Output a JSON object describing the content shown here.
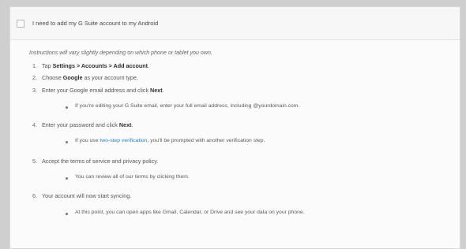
{
  "header": {
    "title": "I need to add my G Suite account to my Android"
  },
  "content": {
    "intro": "Instructions will vary slightly depending on which phone or tablet you own.",
    "steps": [
      {
        "num": "1.",
        "parts": [
          "Tap ",
          "Settings > Accounts > Add account",
          "."
        ]
      },
      {
        "num": "2.",
        "parts": [
          "Choose ",
          "Google",
          " as your account type."
        ]
      },
      {
        "num": "3.",
        "parts": [
          "Enter your Google email address and click ",
          "Next",
          "."
        ]
      },
      {
        "num": "4.",
        "parts": [
          "Enter your password and click ",
          "Next",
          "."
        ]
      },
      {
        "num": "5.",
        "text": "Accept the terms of service and privacy policy."
      },
      {
        "num": "6.",
        "text": "Your account will now start syncing."
      }
    ],
    "subs": {
      "s3": "If you're editing your G Suite email, enter your full email address, including @yourdomain.com.",
      "s4_pre": "If you use ",
      "s4_link": "two-step verification",
      "s4_post": ", you'll be prompted with another verification step.",
      "s5": "You can review all of our terms by clicking them.",
      "s6": "At this point, you can open apps like Gmail, Calendar, or Drive and see your data on your phone."
    }
  }
}
